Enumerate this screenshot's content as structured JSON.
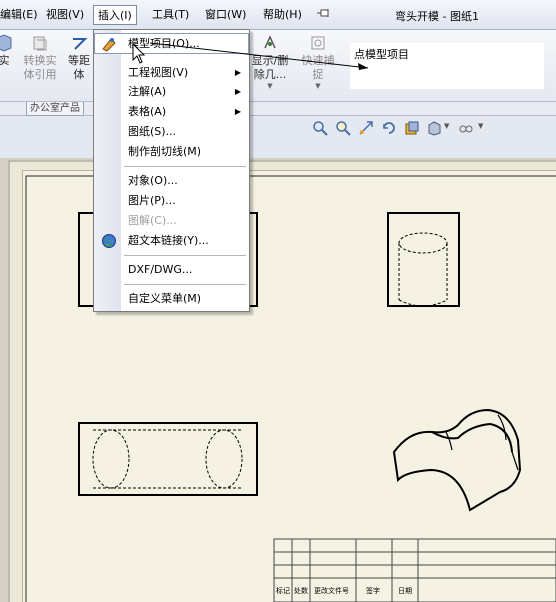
{
  "menubar": {
    "items": [
      {
        "label": "编辑(E)"
      },
      {
        "label": "视图(V)"
      },
      {
        "label": "插入(I)"
      },
      {
        "label": "工具(T)"
      },
      {
        "label": "窗口(W)"
      },
      {
        "label": "帮助(H)"
      }
    ],
    "title": "弯头开模 - 图纸1",
    "pin_icon": "pin-icon"
  },
  "toolbar": {
    "buttons": [
      {
        "label1": "实",
        "label2": ""
      },
      {
        "label1": "转换实",
        "label2": "体引用"
      },
      {
        "label1": "等距",
        "label2": "体"
      },
      {
        "label1": "显示/删",
        "label2": "除几..."
      },
      {
        "label1": "快速捕",
        "label2": "捉"
      }
    ],
    "tab": "办公室产品"
  },
  "callout": {
    "text": "点模型项目"
  },
  "dropdown": {
    "items": [
      {
        "label": "模型项目(O)...",
        "icon": "model-items-icon",
        "submenu": false
      },
      {
        "label": "工程视图(V)",
        "submenu": true
      },
      {
        "label": "注解(A)",
        "submenu": true
      },
      {
        "label": "表格(A)",
        "submenu": true
      },
      {
        "label": "图纸(S)...",
        "submenu": false
      },
      {
        "label": "制作剖切线(M)",
        "submenu": false
      },
      {
        "label": "对象(O)...",
        "submenu": false
      },
      {
        "label": "图片(P)...",
        "submenu": false
      },
      {
        "label": "图解(C)...",
        "submenu": false,
        "disabled": true
      },
      {
        "label": "超文本链接(Y)...",
        "icon": "globe-icon",
        "submenu": false
      },
      {
        "label": "DXF/DWG...",
        "submenu": false
      },
      {
        "label": "自定义菜单(M)",
        "submenu": false
      }
    ]
  },
  "title_block": {
    "labels": [
      "标记",
      "处数",
      "更改文件号",
      "签字",
      "日期"
    ]
  },
  "colors": {
    "sheet": "#f6f2e3",
    "menu_highlight_border": "#8a9ab8",
    "toolbar_blue": "#2a5caa"
  }
}
